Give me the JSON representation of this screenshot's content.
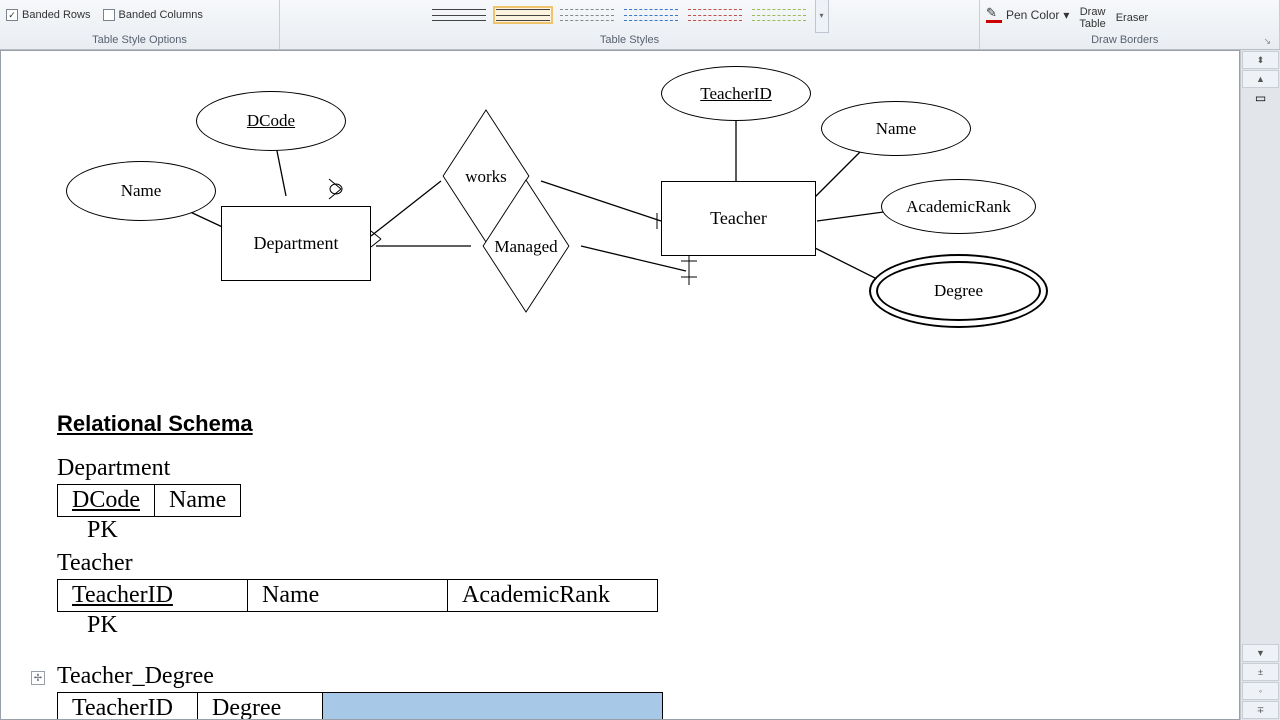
{
  "ribbon": {
    "options": {
      "banded_rows": "Banded Rows",
      "banded_cols": "Banded Columns",
      "group_label": "Table Style Options"
    },
    "styles": {
      "group_label": "Table Styles"
    },
    "borders": {
      "pen_color": "Pen Color",
      "draw_table_l1": "Draw",
      "draw_table_l2": "Table",
      "eraser": "Eraser",
      "group_label": "Draw Borders"
    }
  },
  "er": {
    "dcode": "DCode",
    "name_dept": "Name",
    "department": "Department",
    "works": "works",
    "managed": "Managed",
    "teacher": "Teacher",
    "teacher_id": "TeacherID",
    "name_teacher": "Name",
    "academic_rank": "AcademicRank",
    "degree": "Degree"
  },
  "schema": {
    "heading": "Relational Schema",
    "t1": {
      "name": "Department",
      "c1": "DCode",
      "c2": "Name",
      "pk": "PK"
    },
    "t2": {
      "name": "Teacher",
      "c1": "TeacherID",
      "c2": "Name",
      "c3": "AcademicRank",
      "pk": "PK"
    },
    "t3": {
      "name": "Teacher_Degree",
      "c1": "TeacherID",
      "c2": "Degree",
      "c3": ""
    }
  }
}
